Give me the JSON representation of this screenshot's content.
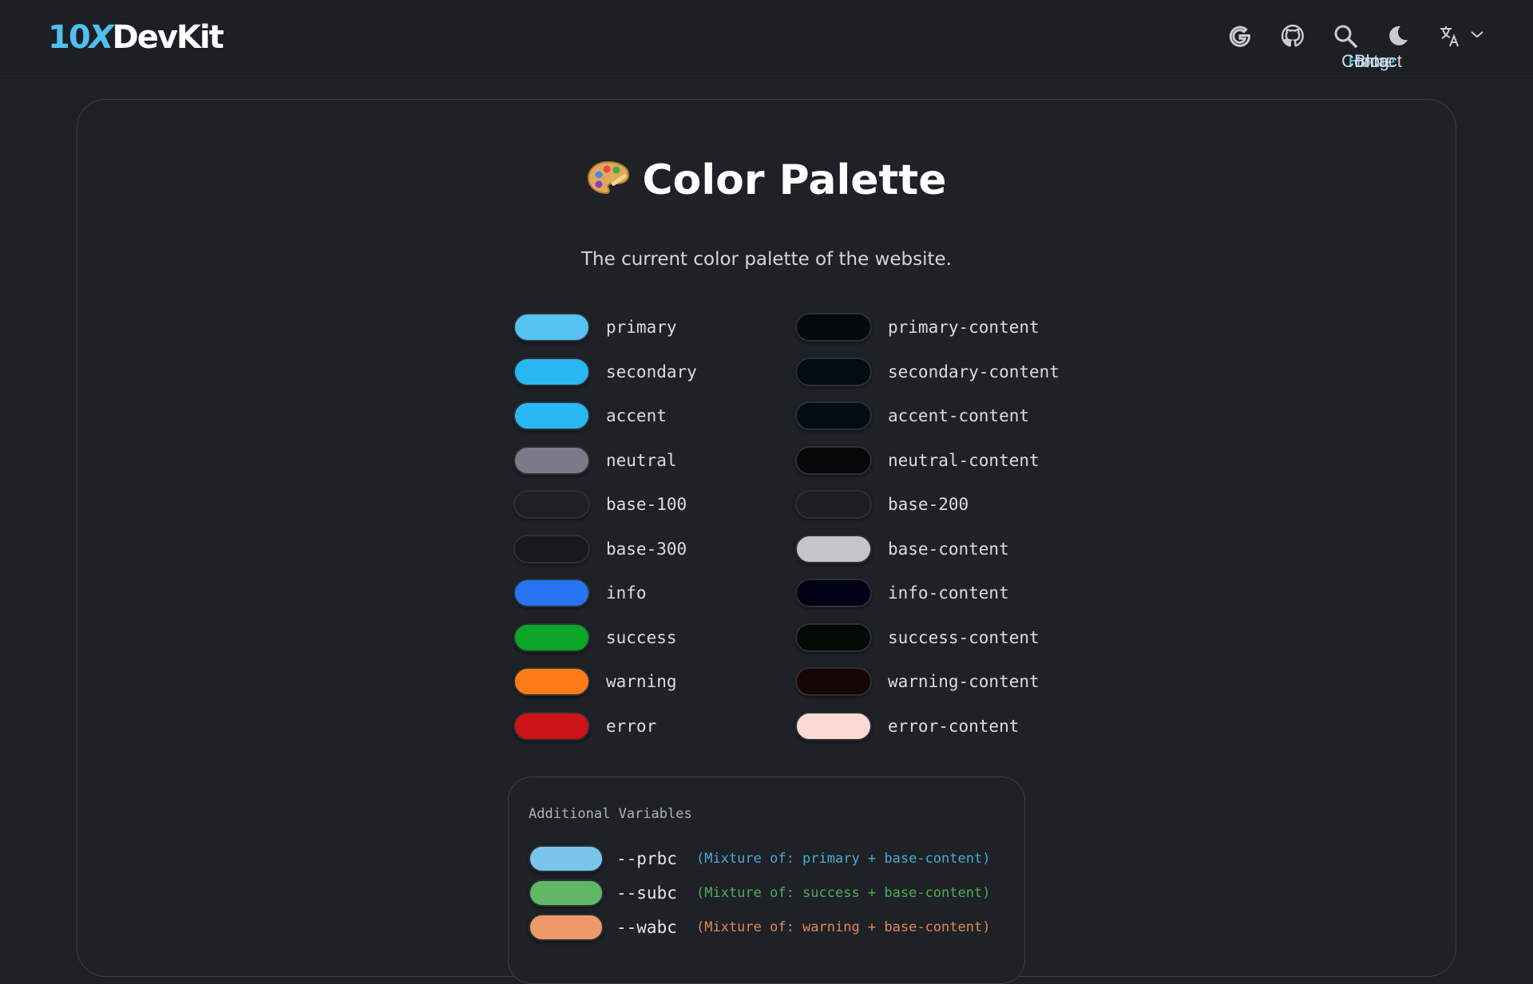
{
  "header": {
    "logo": {
      "part1": "10",
      "part2": "X",
      "part3": "DevKit"
    },
    "nav": [
      {
        "label": "Home",
        "active": true
      },
      {
        "label": "Blog",
        "active": false
      },
      {
        "label": "Contact",
        "active": false
      }
    ],
    "tools": [
      "google-icon",
      "github-icon",
      "search-icon",
      "moon-icon",
      "translate-icon"
    ]
  },
  "main": {
    "title": "Color Palette",
    "subtitle": "The current color palette of the website.",
    "colors_left": [
      {
        "name": "primary",
        "color": "#56c2f1"
      },
      {
        "name": "secondary",
        "color": "#28b7f1"
      },
      {
        "name": "accent",
        "color": "#28b7f1"
      },
      {
        "name": "neutral",
        "color": "#7a7b89"
      },
      {
        "name": "base-100",
        "color": "#1d2024"
      },
      {
        "name": "base-300",
        "color": "#16191c"
      },
      {
        "name": "info",
        "color": "#2774f3"
      },
      {
        "name": "success",
        "color": "#0aa625"
      },
      {
        "name": "warning",
        "color": "#fe7b19"
      },
      {
        "name": "error",
        "color": "#cd1218"
      }
    ],
    "colors_right": [
      {
        "name": "primary-content",
        "color": "#03090d"
      },
      {
        "name": "secondary-content",
        "color": "#010c14"
      },
      {
        "name": "accent-content",
        "color": "#010c14"
      },
      {
        "name": "neutral-content",
        "color": "#050605"
      },
      {
        "name": "base-200",
        "color": "#1b1e22"
      },
      {
        "name": "base-content",
        "color": "#c2c6cb"
      },
      {
        "name": "info-content",
        "color": "#010218"
      },
      {
        "name": "success-content",
        "color": "#020a03"
      },
      {
        "name": "warning-content",
        "color": "#170404"
      },
      {
        "name": "error-content",
        "color": "#fddad3"
      }
    ],
    "additional": {
      "title": "Additional Variables",
      "items": [
        {
          "name": "--prbc",
          "desc": "(Mixture of: primary + base-content)",
          "color": "#7ac5ec",
          "desc_color": "#4aa9d8"
        },
        {
          "name": "--subc",
          "desc": "(Mixture of: success + base-content)",
          "color": "#5fb964",
          "desc_color": "#4caf55"
        },
        {
          "name": "--wabc",
          "desc": "(Mixture of: warning + base-content)",
          "color": "#ee9a68",
          "desc_color": "#e0875a"
        }
      ]
    }
  }
}
